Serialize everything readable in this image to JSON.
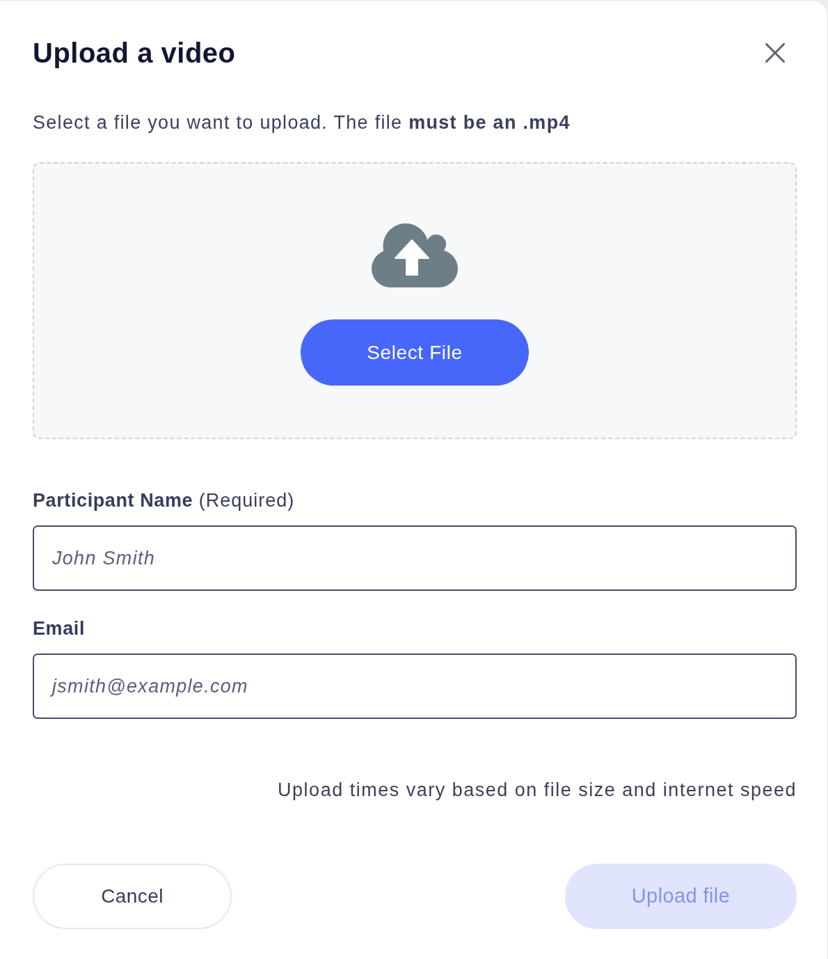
{
  "dialog": {
    "title": "Upload a video",
    "description": "Select a file you want to upload. The file **must be an .mp4**"
  },
  "dropzone": {
    "button": "Select File"
  },
  "fields": [
    {
      "label": "Participant Name",
      "note": "(Required)",
      "placeholder": "John Smith"
    },
    {
      "label": "Email",
      "placeholder": "jsmith@example.com"
    }
  ],
  "note": "Upload times vary based on file size and internet speed",
  "buttons": [
    {
      "label": "Cancel",
      "kind": "secondary",
      "disabled": false
    },
    {
      "label": "Upload file",
      "kind": "primary",
      "disabled": true
    }
  ]
}
